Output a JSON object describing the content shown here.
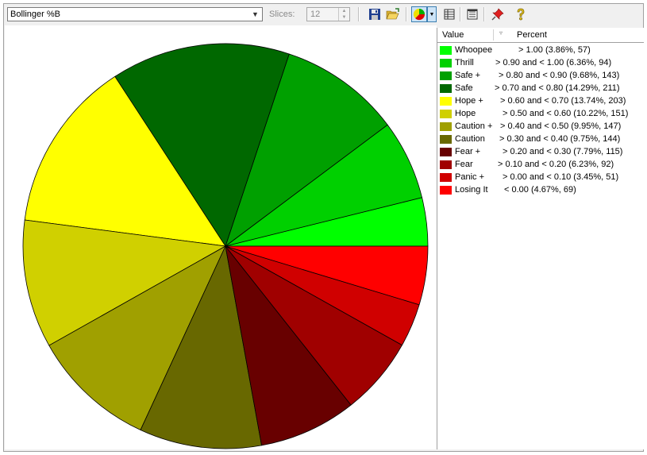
{
  "toolbar": {
    "indicator_select": "Bollinger %B",
    "slices_label": "Slices:",
    "slices_value": "12"
  },
  "legend": {
    "header_value": "Value",
    "header_percent": "Percent",
    "rows": [
      {
        "label": "Whoopee",
        "range": "> 1.00 (3.86%, 57)",
        "color": "#00ff00"
      },
      {
        "label": "Thrill",
        "range": "> 0.90 and < 1.00 (6.36%, 94)",
        "color": "#00d000"
      },
      {
        "label": "Safe +",
        "range": "> 0.80 and < 0.90 (9.68%, 143)",
        "color": "#00a000"
      },
      {
        "label": "Safe",
        "range": "> 0.70 and < 0.80 (14.29%, 211)",
        "color": "#006800"
      },
      {
        "label": "Hope +",
        "range": "> 0.60 and < 0.70 (13.74%, 203)",
        "color": "#ffff00"
      },
      {
        "label": "Hope",
        "range": "> 0.50 and < 0.60 (10.22%, 151)",
        "color": "#d0d000"
      },
      {
        "label": "Caution +",
        "range": "> 0.40 and < 0.50 (9.95%, 147)",
        "color": "#a0a000"
      },
      {
        "label": "Caution",
        "range": "> 0.30 and < 0.40 (9.75%, 144)",
        "color": "#686800"
      },
      {
        "label": "Fear +",
        "range": "> 0.20 and < 0.30 (7.79%, 115)",
        "color": "#680000"
      },
      {
        "label": "Fear",
        "range": "> 0.10 and < 0.20 (6.23%, 92)",
        "color": "#a00000"
      },
      {
        "label": "Panic +",
        "range": "> 0.00 and < 0.10 (3.45%, 51)",
        "color": "#d00000"
      },
      {
        "label": "Losing It",
        "range": "< 0.00 (4.67%, 69)",
        "color": "#ff0000"
      }
    ]
  },
  "chart_data": {
    "type": "pie",
    "categories": [
      "Whoopee",
      "Thrill",
      "Safe +",
      "Safe",
      "Hope +",
      "Hope",
      "Caution +",
      "Caution",
      "Fear +",
      "Fear",
      "Panic +",
      "Losing It"
    ],
    "values": [
      57,
      94,
      143,
      211,
      203,
      151,
      147,
      144,
      115,
      92,
      51,
      69
    ],
    "percents": [
      3.86,
      6.36,
      9.68,
      14.29,
      13.74,
      10.22,
      9.95,
      9.75,
      7.79,
      6.23,
      3.45,
      4.67
    ],
    "colors": [
      "#00ff00",
      "#00d000",
      "#00a000",
      "#006800",
      "#ffff00",
      "#d0d000",
      "#a0a000",
      "#686800",
      "#680000",
      "#a00000",
      "#d00000",
      "#ff0000"
    ],
    "start": "3 o'clock",
    "direction": "counterclockwise",
    "legend_position": "right"
  }
}
